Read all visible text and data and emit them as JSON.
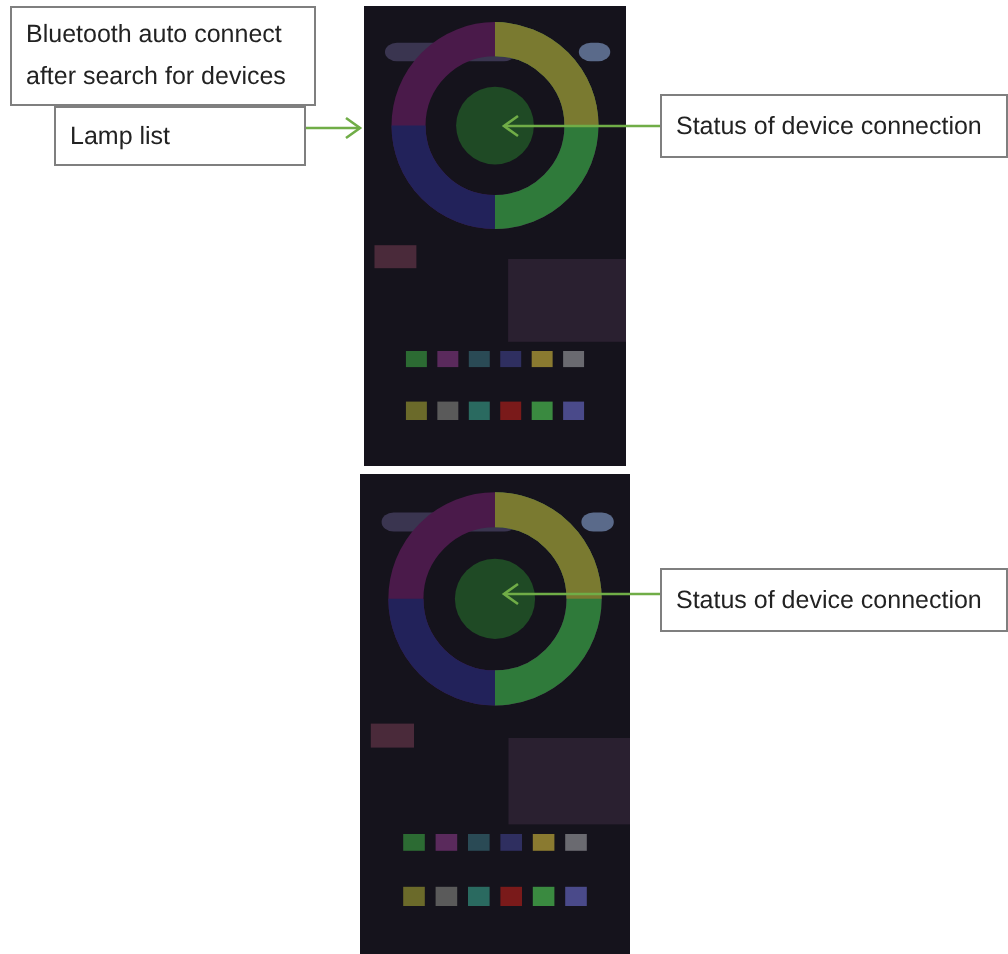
{
  "screenshots": [
    {
      "kind": "screenshot"
    },
    {
      "kind": "screenshot"
    }
  ],
  "callouts": [
    {
      "lines": [
        "Bluetooth auto connect",
        "after search for devices"
      ]
    },
    {
      "lines": [
        "Lamp list"
      ]
    },
    {
      "lines": [
        "Status of device connection"
      ]
    },
    {
      "lines": [
        "Status of device connection"
      ]
    }
  ]
}
